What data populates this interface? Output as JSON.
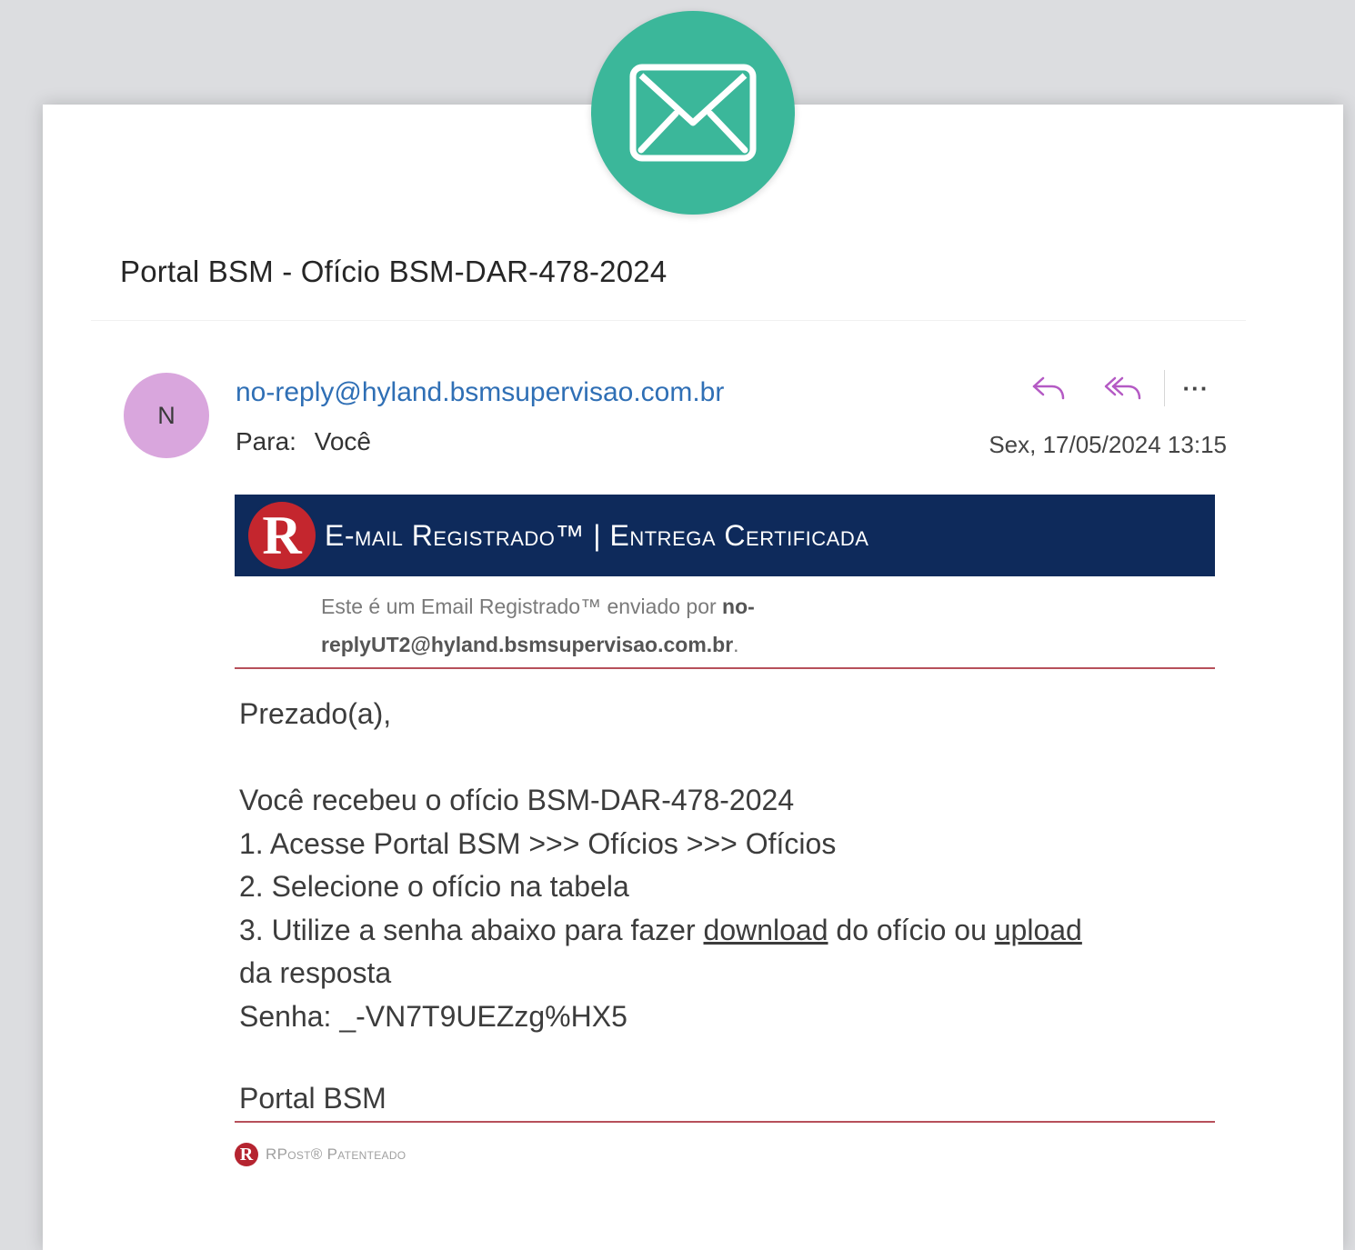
{
  "subject": "Portal BSM - Ofício BSM-DAR-478-2024",
  "sender": {
    "initial": "N",
    "email": "no-reply@hyland.bsmsupervisao.com.br",
    "to_label": "Para:",
    "to_value": "Você",
    "date": "Sex, 17/05/2024 13:15"
  },
  "actions": {
    "reply_icon": "reply-icon",
    "reply_all_icon": "reply-all-icon",
    "more_label": "···"
  },
  "badge": {
    "icon": "envelope-icon",
    "color": "#3bb79a"
  },
  "banner": {
    "logo_letter": "R",
    "title": "E-mail Registrado™ | Entrega Certificada",
    "background": "#0e2a5b",
    "logo_color": "#c4262e"
  },
  "registered_note": {
    "prefix": "Este é um Email Registrado™ enviado por ",
    "address": "no-replyUT2@hyland.bsmsupervisao.com.br",
    "suffix": "."
  },
  "body": {
    "greeting": "Prezado(a),",
    "line1": "Você recebeu o ofício BSM-DAR-478-2024",
    "line2": "1. Acesse Portal BSM >>> Ofícios >>> Ofícios",
    "line3": "2. Selecione o ofício na tabela",
    "line4_pre": "3. Utilize a senha abaixo para fazer ",
    "line4_link1": "download",
    "line4_mid": " do ofício ou ",
    "line4_link2": "upload",
    "line5": "da resposta",
    "line6": "Senha: _-VN7T9UEZzg%HX5"
  },
  "signature": "Portal BSM",
  "footer": {
    "logo_letter": "R",
    "text": "RPost® Patenteado"
  }
}
